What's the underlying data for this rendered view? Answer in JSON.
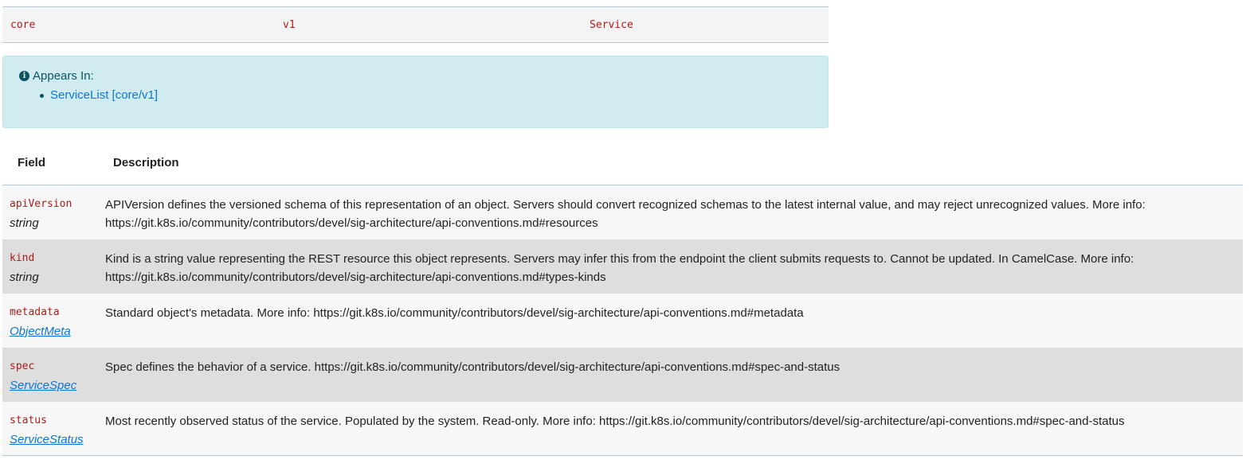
{
  "gvk": {
    "group": "core",
    "version": "v1",
    "kind": "Service"
  },
  "appears_in": {
    "title": "Appears In:",
    "items": [
      {
        "label": "ServiceList [core/v1]"
      }
    ]
  },
  "fields_table": {
    "headers": {
      "field": "Field",
      "description": "Description"
    },
    "rows": [
      {
        "name": "apiVersion",
        "type": "string",
        "description": "APIVersion defines the versioned schema of this representation of an object. Servers should convert recognized schemas to the latest internal value, and may reject unrecognized values. More info: https://git.k8s.io/community/contributors/devel/sig-architecture/api-conventions.md#resources"
      },
      {
        "name": "kind",
        "type": "string",
        "description": "Kind is a string value representing the REST resource this object represents. Servers may infer this from the endpoint the client submits requests to. Cannot be updated. In CamelCase. More info: https://git.k8s.io/community/contributors/devel/sig-architecture/api-conventions.md#types-kinds"
      },
      {
        "name": "metadata",
        "type": "ObjectMeta",
        "description": "Standard object's metadata. More info: https://git.k8s.io/community/contributors/devel/sig-architecture/api-conventions.md#metadata"
      },
      {
        "name": "spec",
        "type": "ServiceSpec",
        "description": "Spec defines the behavior of a service. https://git.k8s.io/community/contributors/devel/sig-architecture/api-conventions.md#spec-and-status"
      },
      {
        "name": "status",
        "type": "ServiceStatus",
        "description": "Most recently observed status of the service. Populated by the system. Read-only. More info: https://git.k8s.io/community/contributors/devel/sig-architecture/api-conventions.md#spec-and-status"
      }
    ]
  },
  "colors": {
    "field_name": "#b11a1a",
    "link": "#0b76d6",
    "alert_bg": "#d1ecf1",
    "alert_text": "#0c5460",
    "row_alt": "#dedede",
    "row_plain": "#f7f7f7"
  },
  "icons": {
    "appears_in": "info-circle-icon"
  }
}
